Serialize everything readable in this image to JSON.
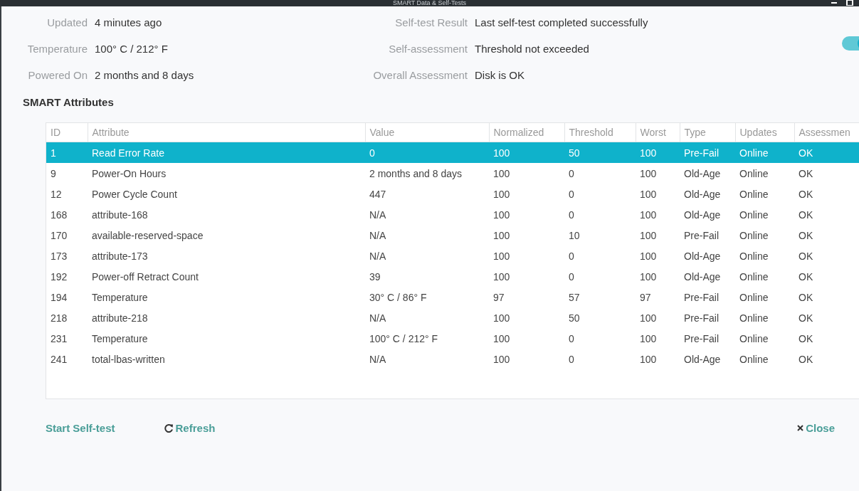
{
  "window": {
    "title": "SMART Data & Self-Tests"
  },
  "summary_left": [
    {
      "label": "Updated",
      "value": "4 minutes ago"
    },
    {
      "label": "Temperature",
      "value": "100° C / 212° F"
    },
    {
      "label": "Powered On",
      "value": "2 months and 8 days"
    }
  ],
  "summary_right": [
    {
      "label": "Self-test Result",
      "value": "Last self-test completed successfully"
    },
    {
      "label": "Self-assessment",
      "value": "Threshold not exceeded"
    },
    {
      "label": "Overall Assessment",
      "value": "Disk is OK"
    }
  ],
  "toggle": {
    "on": true
  },
  "section_title": "SMART Attributes",
  "table": {
    "columns": [
      "ID",
      "Attribute",
      "Value",
      "Normalized",
      "Threshold",
      "Worst",
      "Type",
      "Updates",
      "Assessmen"
    ],
    "rows": [
      {
        "selected": true,
        "cells": [
          "1",
          "Read Error Rate",
          "0",
          "100",
          "50",
          "100",
          "Pre-Fail",
          "Online",
          "OK"
        ]
      },
      {
        "selected": false,
        "cells": [
          "9",
          "Power-On Hours",
          "2 months and 8 days",
          "100",
          "0",
          "100",
          "Old-Age",
          "Online",
          "OK"
        ]
      },
      {
        "selected": false,
        "cells": [
          "12",
          "Power Cycle Count",
          "447",
          "100",
          "0",
          "100",
          "Old-Age",
          "Online",
          "OK"
        ]
      },
      {
        "selected": false,
        "cells": [
          "168",
          "attribute-168",
          "N/A",
          "100",
          "0",
          "100",
          "Old-Age",
          "Online",
          "OK"
        ]
      },
      {
        "selected": false,
        "cells": [
          "170",
          "available-reserved-space",
          "N/A",
          "100",
          "10",
          "100",
          "Pre-Fail",
          "Online",
          "OK"
        ]
      },
      {
        "selected": false,
        "cells": [
          "173",
          "attribute-173",
          "N/A",
          "100",
          "0",
          "100",
          "Old-Age",
          "Online",
          "OK"
        ]
      },
      {
        "selected": false,
        "cells": [
          "192",
          "Power-off Retract Count",
          "39",
          "100",
          "0",
          "100",
          "Old-Age",
          "Online",
          "OK"
        ]
      },
      {
        "selected": false,
        "cells": [
          "194",
          "Temperature",
          "30° C / 86° F",
          "97",
          "57",
          "97",
          "Pre-Fail",
          "Online",
          "OK"
        ]
      },
      {
        "selected": false,
        "cells": [
          "218",
          "attribute-218",
          "N/A",
          "100",
          "50",
          "100",
          "Pre-Fail",
          "Online",
          "OK"
        ]
      },
      {
        "selected": false,
        "cells": [
          "231",
          "Temperature",
          "100° C / 212° F",
          "100",
          "0",
          "100",
          "Pre-Fail",
          "Online",
          "OK"
        ]
      },
      {
        "selected": false,
        "cells": [
          "241",
          "total-lbas-written",
          "N/A",
          "100",
          "0",
          "100",
          "Old-Age",
          "Online",
          "OK"
        ]
      }
    ]
  },
  "buttons": {
    "start": "Start Self-test",
    "refresh": "Refresh",
    "close": "Close"
  }
}
